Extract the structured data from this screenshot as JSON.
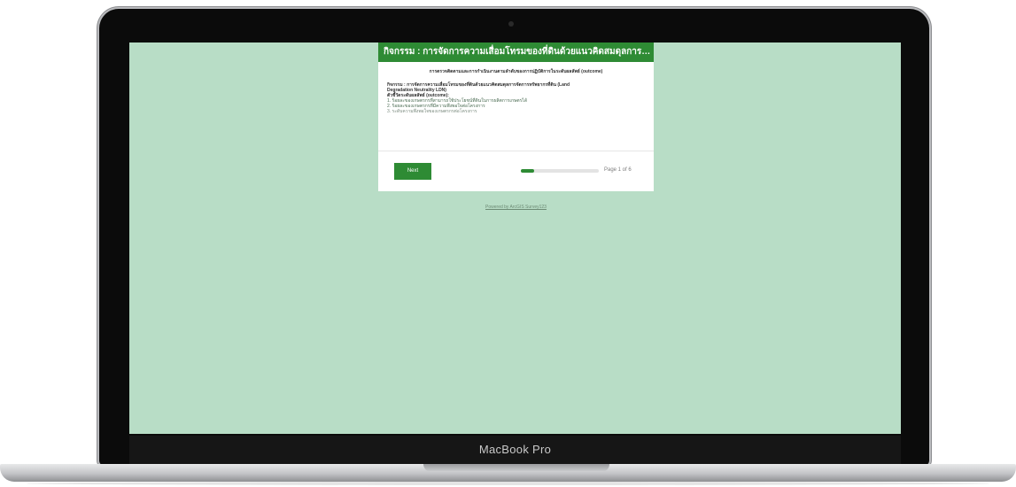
{
  "device": {
    "label": "MacBook Pro"
  },
  "survey": {
    "header_title": "กิจกรรม : การจัดการความเสื่อมโทรมของที่ดินด้วยแนวคิดสมดุลการจัดก...",
    "subtitle": "การตรวจติดตามและการกำเนินงานตามลำดับของการปฏิบัติการในระดับผลลัพธ์ (outcome)",
    "activity_line1": "กิจกรรม : การจัดการความเสื่อมโทรมของที่ดินด้วยแนวคิดสมดุลการจัดการทรัพยากรที่ดิน (Land",
    "activity_line2": "Degradation Neutrality LDN)",
    "outcome_label": "ตัวชี้วัดระดับผลลัพธ์ (outcome):",
    "items": [
      "1. ร้อยละของเกษตรกรที่สามารถใช้ประโยชน์ที่ดินในการผลิตการเกษตรได้",
      "2. ร้อยละของเกษตรกรที่มีความพึงพอใจต่อโครงการ",
      "3. ระดับความพึงพอใจของเกษตรกรต่อโครงการ"
    ],
    "next_label": "Next",
    "progress_fraction": 0.17,
    "page_text": "Page 1 of 6",
    "powered_by": "Powered by ArcGIS Survey123"
  },
  "colors": {
    "screen_background": "#b8ddc6",
    "accent": "#2e8b34"
  }
}
